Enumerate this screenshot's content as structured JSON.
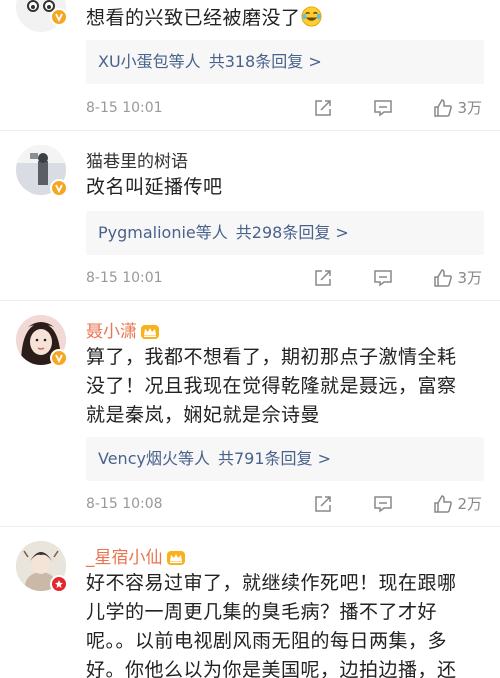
{
  "comments": [
    {
      "username": "",
      "text": "想看的兴致已经被磨没了",
      "emoji_name": "laughing-crying-emoji",
      "replies_users": "XU小蛋包等人",
      "replies_count": "共318条回复 >",
      "time": "8-15 10:01",
      "likes": "3万"
    },
    {
      "username": "猫巷里的树语",
      "text": "改名叫延播传吧",
      "replies_users": "Pygmalionie等人",
      "replies_count": "共298条回复 >",
      "time": "8-15 10:01",
      "likes": "3万"
    },
    {
      "username": "聂小潇",
      "text_lines": [
        "算了，我都不想看了，期初那点子激情全耗",
        "没了！况且我现在觉得乾隆就是聂远，富察",
        "就是秦岚，娴妃就是佘诗曼"
      ],
      "replies_users": "Vency烟火等人",
      "replies_count": "共791条回复 >",
      "time": "8-15 10:08",
      "likes": "2万"
    },
    {
      "username": "_星宿小仙",
      "text_lines": [
        "好不容易过审了，就继续作死吧！现在跟哪",
        "儿学的一周更几集的臭毛病？播不了才好",
        "呢。。以前电视剧风雨无阻的每日两集，多",
        "好。你他么以为你是美国呢，边拍边播，还"
      ]
    }
  ],
  "colors": {
    "link": "#49628c",
    "vip_name": "#eb7350",
    "meta": "#999999",
    "reply_bg": "#f7f7f7"
  },
  "icons": [
    "share-icon",
    "comment-icon",
    "like-icon",
    "crown-icon",
    "verified-badge-icon"
  ]
}
